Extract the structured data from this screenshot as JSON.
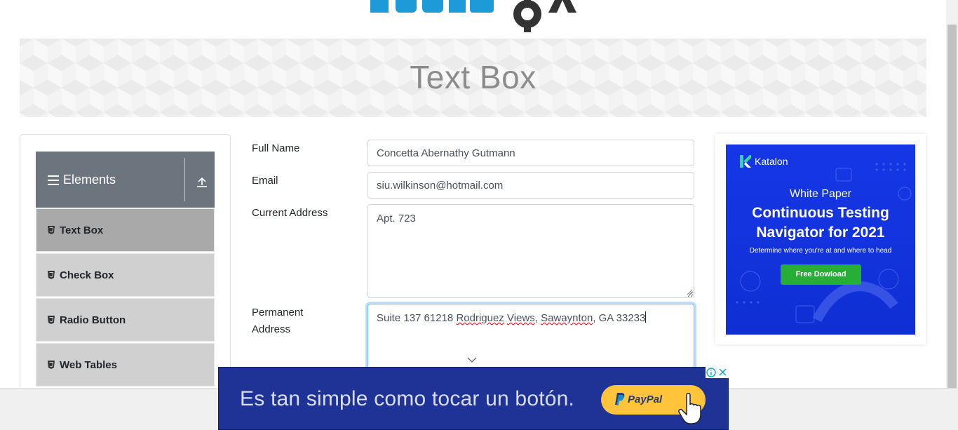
{
  "brand": {
    "logo_alt": "TOOLSQA"
  },
  "banner": {
    "title": "Text Box"
  },
  "sidebar": {
    "group": {
      "title": "Elements"
    },
    "items": [
      {
        "label": "Text Box",
        "active": true
      },
      {
        "label": "Check Box",
        "active": false
      },
      {
        "label": "Radio Button",
        "active": false
      },
      {
        "label": "Web Tables",
        "active": false
      }
    ]
  },
  "form": {
    "full_name": {
      "label": "Full Name",
      "value": "Concetta Abernathy Gutmann"
    },
    "email": {
      "label": "Email",
      "value": "siu.wilkinson@hotmail.com"
    },
    "current_address": {
      "label": "Current Address",
      "value": "Apt. 723"
    },
    "permanent_address": {
      "label_line1": "Permanent",
      "label_line2": "Address",
      "value_parts": [
        "Suite 137 61218 ",
        "Rodriguez",
        " ",
        "Views",
        ", ",
        "Sawaynton",
        ", GA 33233"
      ]
    }
  },
  "side_ad": {
    "brand": "Katalon",
    "kicker": "White Paper",
    "headline_line1": "Continuous Testing",
    "headline_line2": "Navigator for 2021",
    "sub": "Determine where you're at and where to head",
    "cta": "Free Dowload"
  },
  "bottom_ad": {
    "text": "Es tan simple como tocar un botón.",
    "button": "PayPal"
  },
  "colors": {
    "sidebar_header": "#6c757d",
    "sidebar_item": "#d0d0d0",
    "sidebar_item_active": "#a9a9a9",
    "ad_blue": "#1637e6",
    "cta_green": "#27ae37",
    "paypal_yellow": "#ffc439"
  }
}
